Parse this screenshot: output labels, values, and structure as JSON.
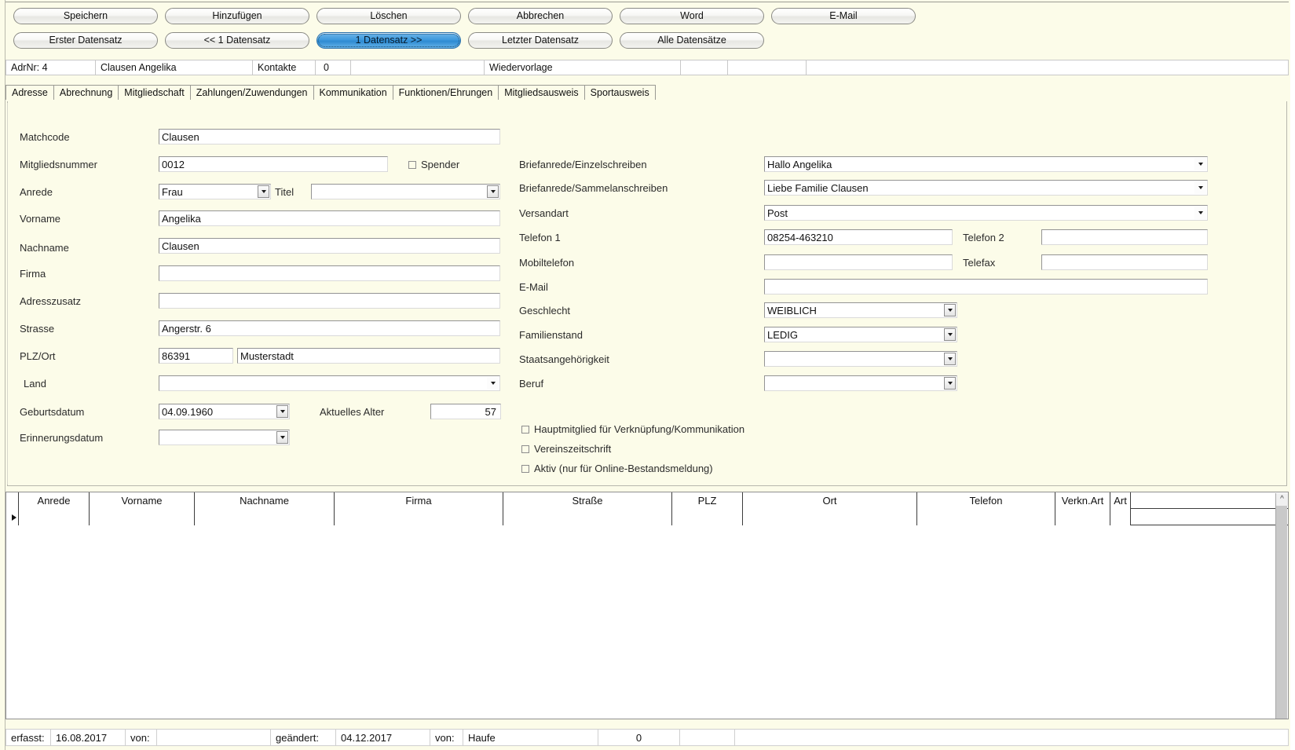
{
  "toolbar": {
    "row1": [
      {
        "label": "Speichern",
        "name": "save-button",
        "selected": false
      },
      {
        "label": "Hinzufügen",
        "name": "add-button",
        "selected": false
      },
      {
        "label": "Löschen",
        "name": "delete-button",
        "selected": false
      },
      {
        "label": "Abbrechen",
        "name": "cancel-button",
        "selected": false
      },
      {
        "label": "Word",
        "name": "word-button",
        "selected": false
      },
      {
        "label": "E-Mail",
        "name": "email-button",
        "selected": false
      }
    ],
    "row2": [
      {
        "label": "Erster Datensatz",
        "name": "first-record-button",
        "selected": false
      },
      {
        "label": "<< 1 Datensatz",
        "name": "previous-record-button",
        "selected": false
      },
      {
        "label": "1 Datensatz >>",
        "name": "next-record-button",
        "selected": true
      },
      {
        "label": "Letzter Datensatz",
        "name": "last-record-button",
        "selected": false
      },
      {
        "label": "Alle Datensätze",
        "name": "all-records-button",
        "selected": false
      }
    ]
  },
  "inforow": {
    "adrnr_label": "AdrNr: 4",
    "person_name": "Clausen Angelika",
    "kontakte_label": "Kontakte",
    "kontakte_count": "0",
    "blank1": "",
    "wiedervorlage_label": "Wiedervorlage",
    "blank2": "",
    "blank3": "",
    "blank4": ""
  },
  "tabs": [
    {
      "label": "Adresse",
      "active": true
    },
    {
      "label": "Abrechnung",
      "active": false
    },
    {
      "label": "Mitgliedschaft",
      "active": false
    },
    {
      "label": "Zahlungen/Zuwendungen",
      "active": false
    },
    {
      "label": "Kommunikation",
      "active": false
    },
    {
      "label": "Funktionen/Ehrungen",
      "active": false
    },
    {
      "label": "Mitgliedsausweis",
      "active": false
    },
    {
      "label": "Sportausweis",
      "active": false
    }
  ],
  "form": {
    "matchcode_label": "Matchcode",
    "matchcode_value": "Clausen",
    "mitgliedsnummer_label": "Mitgliedsnummer",
    "mitgliedsnummer_value": "0012",
    "spender_label": "Spender",
    "anrede_label": "Anrede",
    "anrede_value": "Frau",
    "titel_label": "Titel",
    "titel_value": "",
    "vorname_label": "Vorname",
    "vorname_value": "Angelika",
    "nachname_label": "Nachname",
    "nachname_value": "Clausen",
    "firma_label": "Firma",
    "firma_value": "",
    "adresszusatz_label": "Adresszusatz",
    "adresszusatz_value": "",
    "strasse_label": "Strasse",
    "strasse_value": "Angerstr. 6",
    "plzort_label": "PLZ/Ort",
    "plz_value": "86391",
    "ort_value": "Musterstadt",
    "land_label": "Land",
    "land_value": "",
    "geburtsdatum_label": "Geburtsdatum",
    "geburtsdatum_value": "04.09.1960",
    "alter_label": "Aktuelles Alter",
    "alter_value": "57",
    "erinnerungsdatum_label": "Erinnerungsdatum",
    "erinnerungsdatum_value": "",
    "briefanrede_einzel_label": "Briefanrede/Einzelschreiben",
    "briefanrede_einzel_value": "Hallo Angelika",
    "briefanrede_sammel_label": "Briefanrede/Sammelanschreiben",
    "briefanrede_sammel_value": "Liebe Familie Clausen",
    "versandart_label": "Versandart",
    "versandart_value": "Post",
    "telefon1_label": "Telefon 1",
    "telefon1_value": "08254-463210",
    "telefon2_label": "Telefon 2",
    "telefon2_value": "",
    "mobiltelefon_label": "Mobiltelefon",
    "mobiltelefon_value": "",
    "telefax_label": "Telefax",
    "telefax_value": "",
    "email_label": "E-Mail",
    "email_value": "",
    "geschlecht_label": "Geschlecht",
    "geschlecht_value": "WEIBLICH",
    "familienstand_label": "Familienstand",
    "familienstand_value": "LEDIG",
    "staatsangehoerigkeit_label": "Staatsangehörigkeit",
    "staatsangehoerigkeit_value": "",
    "beruf_label": "Beruf",
    "beruf_value": "",
    "cb_hauptmitglied": "Hauptmitglied für Verknüpfung/Kommunikation",
    "cb_vereinszeitschrift": "Vereinszeitschrift",
    "cb_aktiv": "Aktiv (nur für Online-Bestandsmeldung)"
  },
  "grid": {
    "columns": [
      "Anrede",
      "Vorname",
      "Nachname",
      "Firma",
      "Straße",
      "PLZ",
      "Ort",
      "Telefon",
      "Verkn.Art",
      "Art"
    ],
    "rows": [
      {
        "cells": [
          "",
          "",
          "",
          "",
          "",
          "",
          "",
          "",
          "",
          ""
        ],
        "selected": true
      }
    ],
    "scroll_up_icon": "chevron-up-icon"
  },
  "statusbar": {
    "erfasst_label": "erfasst:",
    "erfasst_value": "16.08.2017",
    "von1_label": "von:",
    "von1_value": "",
    "geaendert_label": "geändert:",
    "geaendert_value": "04.12.2017",
    "von2_label": "von:",
    "von2_value": "Haufe",
    "count_value": "0",
    "blank1": "",
    "blank2": ""
  },
  "colors": {
    "panel_bg": "#fcfce9",
    "selected_button": "#3f9add",
    "field_bg": "#ffffff",
    "grid_border": "#3c3c3c"
  }
}
